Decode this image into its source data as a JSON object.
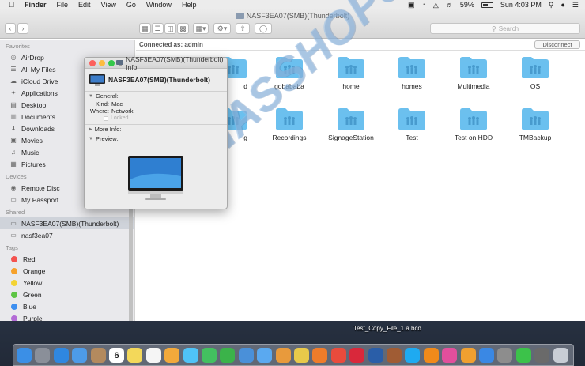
{
  "menubar": {
    "app": "Finder",
    "items": [
      "File",
      "Edit",
      "View",
      "Go",
      "Window",
      "Help"
    ],
    "battery": "59%",
    "battery_level": 0.59,
    "clock": "Sun 4:03 PM"
  },
  "window": {
    "title": "NASF3EA07(SMB)(Thunderbolt)",
    "search_placeholder": "Search",
    "connected_as": "Connected as: admin",
    "disconnect_label": "Disconnect"
  },
  "sidebar": {
    "favorites_header": "Favorites",
    "favorites": [
      {
        "label": "AirDrop",
        "icon": "airdrop-icon"
      },
      {
        "label": "All My Files",
        "icon": "files-icon"
      },
      {
        "label": "iCloud Drive",
        "icon": "cloud-icon"
      },
      {
        "label": "Applications",
        "icon": "applications-icon"
      },
      {
        "label": "Desktop",
        "icon": "desktop-icon"
      },
      {
        "label": "Documents",
        "icon": "documents-icon"
      },
      {
        "label": "Downloads",
        "icon": "downloads-icon"
      },
      {
        "label": "Movies",
        "icon": "movies-icon"
      },
      {
        "label": "Music",
        "icon": "music-icon"
      },
      {
        "label": "Pictures",
        "icon": "pictures-icon"
      }
    ],
    "devices_header": "Devices",
    "devices": [
      {
        "label": "Remote Disc",
        "icon": "disc-icon"
      },
      {
        "label": "My Passport",
        "icon": "drive-icon"
      }
    ],
    "shared_header": "Shared",
    "shared": [
      {
        "label": "NASF3EA07(SMB)(Thunderbolt)",
        "icon": "monitor-icon",
        "selected": true
      },
      {
        "label": "nasf3ea07",
        "icon": "monitor-icon",
        "selected": false
      }
    ],
    "tags_header": "Tags",
    "tags": [
      {
        "label": "Red",
        "color": "#f4524f"
      },
      {
        "label": "Orange",
        "color": "#f6a12a"
      },
      {
        "label": "Yellow",
        "color": "#f3d334"
      },
      {
        "label": "Green",
        "color": "#5ec545"
      },
      {
        "label": "Blue",
        "color": "#3d8ff0"
      },
      {
        "label": "Purple",
        "color": "#b36bd6"
      }
    ]
  },
  "folders": [
    "gobababa",
    "home",
    "homes",
    "Multimedia",
    "OS",
    "Recordings",
    "SignageStation",
    "Test",
    "Test on HDD",
    "TMBackup"
  ],
  "partial_folders": [
    "d",
    "g"
  ],
  "info_window": {
    "title": "NASF3EA07(SMB)(Thunderbolt) Info",
    "name": "NASF3EA07(SMB)(Thunderbolt)",
    "general_label": "General:",
    "kind_label": "Kind:",
    "kind_value": "Mac",
    "where_label": "Where:",
    "where_value": "Network",
    "locked_label": "Locked",
    "more_info_label": "More Info:",
    "preview_label": "Preview:"
  },
  "watermark": "NASSHOPS.net",
  "desktop_file": "Test_Copy_File_1.a bcd",
  "colors": {
    "folder": "#6cc0ee",
    "selection": "#cfd3da",
    "close": "#fc605c",
    "minimize": "#fdbc40",
    "zoom": "#34c84a"
  },
  "dock": {
    "calendar_day": "6",
    "icons": [
      "finder-icon",
      "launchpad-icon",
      "safari-icon",
      "mail-icon",
      "contacts-icon",
      "calendar-icon",
      "notes-icon",
      "reminders-icon",
      "photos-icon",
      "messages-icon",
      "facetime-icon",
      "numbers-icon",
      "keynote-icon",
      "app-store-icon",
      "ibooks-icon",
      "nuke-icon",
      "firefox-icon",
      "chrome-icon",
      "opera-icon",
      "sourcetree-icon",
      "game-icon",
      "skype-icon",
      "vlc-icon",
      "itunes-icon",
      "books-icon",
      "appstore2-icon",
      "system-preferences-icon",
      "line-icon",
      "grid-icon",
      "trash-icon"
    ]
  }
}
